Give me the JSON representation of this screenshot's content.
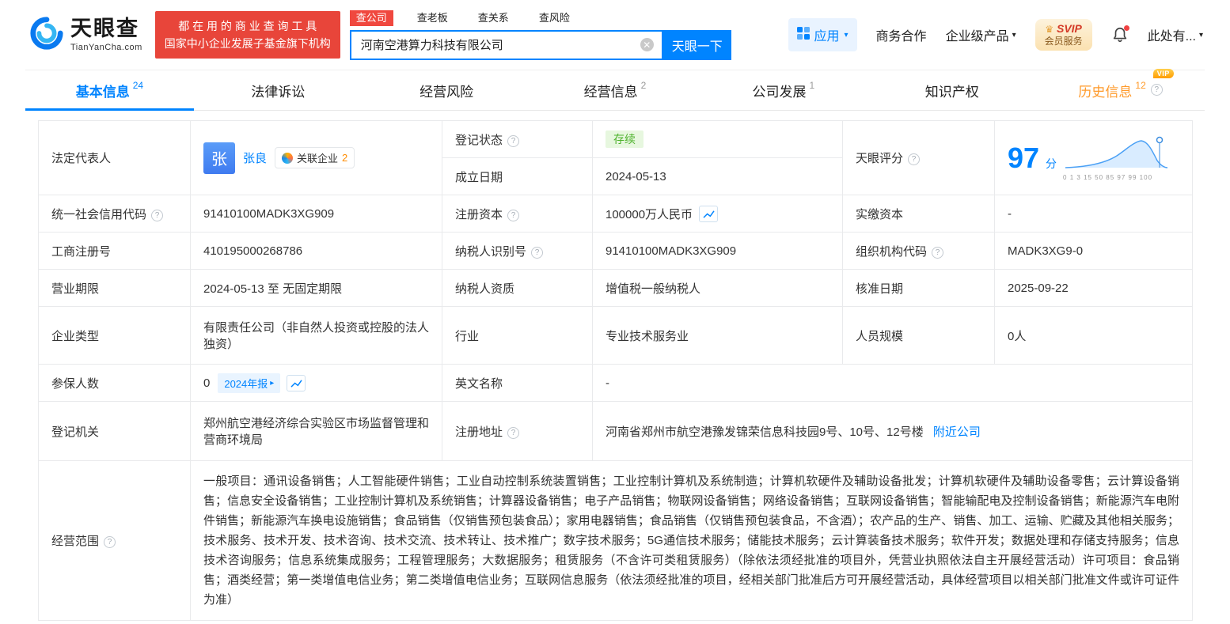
{
  "colors": {
    "accent_blue": "#0084ff",
    "brand_red": "#e8453a",
    "status_green": "#4db22c",
    "history_orange": "#ff9a2a",
    "border_gray": "#e9eaec"
  },
  "header": {
    "logo_title": "天眼查",
    "logo_domain": "TianYanCha.com",
    "slogan_line1": "都 在 用 的 商 业 查 询 工 具",
    "slogan_line2": "国家中小企业发展子基金旗下机构",
    "search_tabs": [
      {
        "label": "查公司"
      },
      {
        "label": "查老板"
      },
      {
        "label": "查关系"
      },
      {
        "label": "查风险"
      }
    ],
    "search_value": "河南空港算力科技有限公司",
    "search_button": "天眼一下",
    "apps_label": "应用",
    "biz_label": "商务合作",
    "enterprise_label": "企业级产品",
    "svip_title": "SVIP",
    "svip_sub": "会员服务",
    "account_label": "此处有..."
  },
  "tabs": {
    "basic": {
      "label": "基本信息",
      "count": "24"
    },
    "legal": {
      "label": "法律诉讼"
    },
    "risk": {
      "label": "经营风险"
    },
    "business": {
      "label": "经营信息",
      "count": "2"
    },
    "development": {
      "label": "公司发展",
      "count": "1"
    },
    "ip": {
      "label": "知识产权"
    },
    "history": {
      "label": "历史信息",
      "count": "12",
      "vip": "VIP"
    }
  },
  "score": {
    "label": "天眼评分",
    "value": "97",
    "unit": "分",
    "axis": "0 1 3 15 50 85 97 99 100"
  },
  "info": {
    "legal_rep_label": "法定代表人",
    "legal_rep_avatar": "张",
    "legal_rep_name": "张良",
    "related_label": "关联企业",
    "related_count": "2",
    "reg_status_label": "登记状态",
    "reg_status_value": "存续",
    "establish_date_label": "成立日期",
    "establish_date_value": "2024-05-13",
    "credit_code_label": "统一社会信用代码",
    "credit_code_value": "91410100MADK3XG909",
    "reg_capital_label": "注册资本",
    "reg_capital_value": "100000万人民币",
    "paid_capital_label": "实缴资本",
    "paid_capital_value": "-",
    "reg_number_label": "工商注册号",
    "reg_number_value": "410195000268786",
    "taxpayer_id_label": "纳税人识别号",
    "taxpayer_id_value": "91410100MADK3XG909",
    "org_code_label": "组织机构代码",
    "org_code_value": "MADK3XG9-0",
    "business_term_label": "营业期限",
    "business_term_value": "2024-05-13 至 无固定期限",
    "taxpayer_quality_label": "纳税人资质",
    "taxpayer_quality_value": "增值税一般纳税人",
    "approval_date_label": "核准日期",
    "approval_date_value": "2025-09-22",
    "company_type_label": "企业类型",
    "company_type_value": "有限责任公司（非自然人投资或控股的法人独资）",
    "industry_label": "行业",
    "industry_value": "专业技术服务业",
    "staff_size_label": "人员规模",
    "staff_size_value": "0人",
    "insured_label": "参保人数",
    "insured_value": "0",
    "insured_badge": "2024年报",
    "english_name_label": "英文名称",
    "english_name_value": "-",
    "reg_authority_label": "登记机关",
    "reg_authority_value": "郑州航空港经济综合实验区市场监督管理和营商环境局",
    "address_label": "注册地址",
    "address_value": "河南省郑州市航空港豫发锦荣信息科技园9号、10号、12号楼",
    "nearby_link": "附近公司",
    "scope_label": "经营范围",
    "scope_value": "一般项目：通讯设备销售；人工智能硬件销售；工业自动控制系统装置销售；工业控制计算机及系统制造；计算机软硬件及辅助设备批发；计算机软硬件及辅助设备零售；云计算设备销售；信息安全设备销售；工业控制计算机及系统销售；计算器设备销售；电子产品销售；物联网设备销售；网络设备销售；互联网设备销售；智能输配电及控制设备销售；新能源汽车电附件销售；新能源汽车换电设施销售；食品销售（仅销售预包装食品）；家用电器销售；食品销售（仅销售预包装食品，不含酒）；农产品的生产、销售、加工、运输、贮藏及其他相关服务；技术服务、技术开发、技术咨询、技术交流、技术转让、技术推广；数字技术服务；5G通信技术服务；储能技术服务；云计算装备技术服务；软件开发；数据处理和存储支持服务；信息技术咨询服务；信息系统集成服务；工程管理服务；大数据服务；租赁服务（不含许可类租赁服务）（除依法须经批准的项目外，凭营业执照依法自主开展经营活动）许可项目：食品销售；酒类经营；第一类增值电信业务；第二类增值电信业务；互联网信息服务（依法须经批准的项目，经相关部门批准后方可开展经营活动，具体经营项目以相关部门批准文件或许可证件为准）"
  }
}
